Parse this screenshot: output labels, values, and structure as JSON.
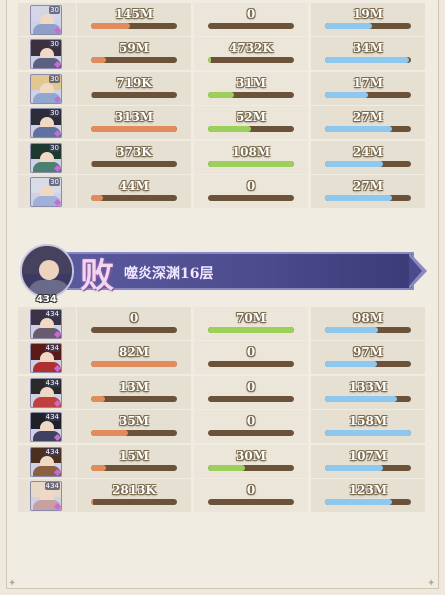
{
  "top_team": [
    {
      "level": "30",
      "hair": "#d4d6e8",
      "coat": "#8fa0c8",
      "stats": [
        {
          "value": "145M",
          "fill": 0.45,
          "color": "orange"
        },
        {
          "value": "0",
          "fill": 0,
          "color": "green"
        },
        {
          "value": "19M",
          "fill": 0.55,
          "color": "blue"
        }
      ]
    },
    {
      "level": "30",
      "hair": "#3a3040",
      "coat": "#5a6080",
      "stats": [
        {
          "value": "59M",
          "fill": 0.18,
          "color": "orange"
        },
        {
          "value": "4732K",
          "fill": 0.04,
          "color": "green"
        },
        {
          "value": "34M",
          "fill": 0.98,
          "color": "blue"
        }
      ]
    },
    {
      "level": "30",
      "hair": "#e0c890",
      "coat": "#90a8d0",
      "stats": [
        {
          "value": "719K",
          "fill": 0.01,
          "color": "orange"
        },
        {
          "value": "31M",
          "fill": 0.3,
          "color": "green"
        },
        {
          "value": "17M",
          "fill": 0.5,
          "color": "blue"
        }
      ]
    },
    {
      "level": "30",
      "hair": "#2c2c3a",
      "coat": "#6070a0",
      "stats": [
        {
          "value": "313M",
          "fill": 1.0,
          "color": "orange"
        },
        {
          "value": "52M",
          "fill": 0.5,
          "color": "green"
        },
        {
          "value": "27M",
          "fill": 0.78,
          "color": "blue"
        }
      ]
    },
    {
      "level": "30",
      "hair": "#1e3a30",
      "coat": "#4a8070",
      "stats": [
        {
          "value": "373K",
          "fill": 0.01,
          "color": "orange"
        },
        {
          "value": "108M",
          "fill": 1.0,
          "color": "green"
        },
        {
          "value": "24M",
          "fill": 0.68,
          "color": "blue"
        }
      ]
    },
    {
      "level": "30",
      "hair": "#d8dce8",
      "coat": "#a0b0d8",
      "stats": [
        {
          "value": "44M",
          "fill": 0.14,
          "color": "orange"
        },
        {
          "value": "0",
          "fill": 0,
          "color": "green"
        },
        {
          "value": "27M",
          "fill": 0.78,
          "color": "blue"
        }
      ]
    }
  ],
  "battle": {
    "result": "败",
    "title": "噬炎深渊16层",
    "power": "434"
  },
  "bottom_team": [
    {
      "level": "434",
      "hair": "#3a3246",
      "coat": "#6a5a70",
      "stats": [
        {
          "value": "0",
          "fill": 0,
          "color": "orange"
        },
        {
          "value": "70M",
          "fill": 1.0,
          "color": "green"
        },
        {
          "value": "98M",
          "fill": 0.62,
          "color": "blue"
        }
      ]
    },
    {
      "level": "434",
      "hair": "#5a1a1a",
      "coat": "#b03030",
      "stats": [
        {
          "value": "82M",
          "fill": 1.0,
          "color": "orange"
        },
        {
          "value": "0",
          "fill": 0,
          "color": "green"
        },
        {
          "value": "97M",
          "fill": 0.61,
          "color": "blue"
        }
      ]
    },
    {
      "level": "434",
      "hair": "#2a2a2a",
      "coat": "#c04040",
      "stats": [
        {
          "value": "13M",
          "fill": 0.16,
          "color": "orange"
        },
        {
          "value": "0",
          "fill": 0,
          "color": "green"
        },
        {
          "value": "133M",
          "fill": 0.84,
          "color": "blue"
        }
      ]
    },
    {
      "level": "434",
      "hair": "#20202a",
      "coat": "#404060",
      "stats": [
        {
          "value": "35M",
          "fill": 0.43,
          "color": "orange"
        },
        {
          "value": "0",
          "fill": 0,
          "color": "green"
        },
        {
          "value": "158M",
          "fill": 1.0,
          "color": "blue"
        }
      ]
    },
    {
      "level": "434",
      "hair": "#4a3020",
      "coat": "#8a6040",
      "stats": [
        {
          "value": "15M",
          "fill": 0.18,
          "color": "orange"
        },
        {
          "value": "30M",
          "fill": 0.43,
          "color": "green"
        },
        {
          "value": "107M",
          "fill": 0.68,
          "color": "blue"
        }
      ]
    },
    {
      "level": "434",
      "hair": "#e8d8c8",
      "coat": "#c8a0a0",
      "stats": [
        {
          "value": "2813K",
          "fill": 0.02,
          "color": "orange"
        },
        {
          "value": "0",
          "fill": 0,
          "color": "green"
        },
        {
          "value": "123M",
          "fill": 0.78,
          "color": "blue"
        }
      ]
    }
  ]
}
